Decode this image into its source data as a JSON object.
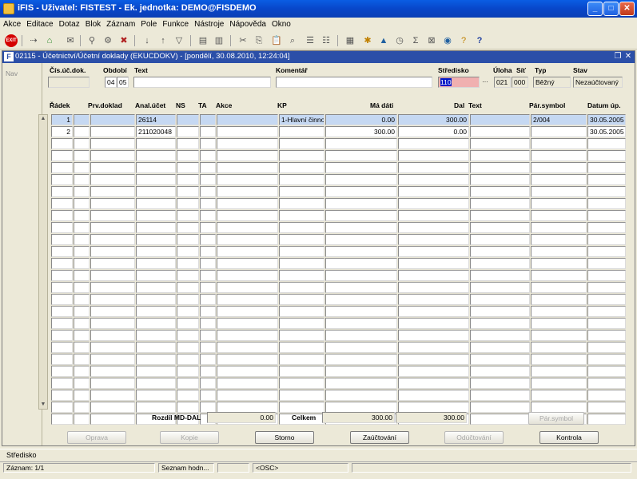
{
  "window": {
    "title": "iFIS - Uživatel: FISTEST - Ek. jednotka: DEMO@FISDEMO"
  },
  "menu": [
    "Akce",
    "Editace",
    "Dotaz",
    "Blok",
    "Záznam",
    "Pole",
    "Funkce",
    "Nástroje",
    "Nápověda",
    "Okno"
  ],
  "toolbar": {
    "exit_label": "EXIT"
  },
  "form": {
    "title": "02115 - Účetnictví/Účetní doklady (EKUCDOKV) - [pondělí, 30.08.2010, 12:24:04]",
    "nav_label": "Nav",
    "labels": {
      "cis_uc_dok": "Čís.úč.dok.",
      "obdobi": "Období",
      "text": "Text",
      "komentar": "Komentář",
      "stredisko": "Středisko",
      "uloha": "Úloha",
      "sit": "Síť",
      "typ": "Typ",
      "stav": "Stav"
    },
    "values": {
      "cis_uc_dok": "",
      "obdobi_month": "04",
      "obdobi_year": "05",
      "text": "",
      "komentar": "",
      "stredisko": "110",
      "uloha": "021",
      "sit": "000",
      "typ": "Běžný",
      "stav": "Nezaúčtovaný"
    }
  },
  "grid": {
    "headers": {
      "radek": "Řádek",
      "prv_doklad": "Prv.doklad",
      "anal_ucet": "Anal.účet",
      "ns": "NS",
      "ta": "TA",
      "akce": "Akce",
      "kp": "KP",
      "ma_dati": "Má dáti",
      "dal": "Dal",
      "text": "Text",
      "par_symbol": "Pár.symbol",
      "datum_up": "Datum úp."
    },
    "rows": [
      {
        "radek": "1",
        "prv_doklad": "",
        "anal_ucet": "26114",
        "ns": "",
        "ta": "",
        "akce": "",
        "kp": "1-Hlavní činno",
        "ma_dati": "0.00",
        "dal": "300.00",
        "text": "",
        "par_symbol": "2/004",
        "datum_up": "30.05.2005"
      },
      {
        "radek": "2",
        "prv_doklad": "",
        "anal_ucet": "211020048",
        "ns": "",
        "ta": "",
        "akce": "",
        "kp": "",
        "ma_dati": "300.00",
        "dal": "0.00",
        "text": "",
        "par_symbol": "",
        "datum_up": "30.05.2005"
      }
    ],
    "empty_rows": 24
  },
  "totals": {
    "rozdil_label": "Rozdíl MD-DAL",
    "rozdil_value": "0.00",
    "celkem_label": "Celkem",
    "celkem_md": "300.00",
    "celkem_dal": "300.00",
    "par_symbol_button": "Pár.symbol"
  },
  "buttons": {
    "oprava": "Oprava",
    "kopie": "Kopie",
    "storno": "Storno",
    "zauctovani": "Zaúčtování",
    "oductovani": "Odúčtování",
    "kontrola": "Kontrola"
  },
  "status": {
    "hint": "Středisko",
    "zaznam": "Záznam: 1/1",
    "seznam": "Seznam hodn...",
    "osc": "<OSC>"
  }
}
